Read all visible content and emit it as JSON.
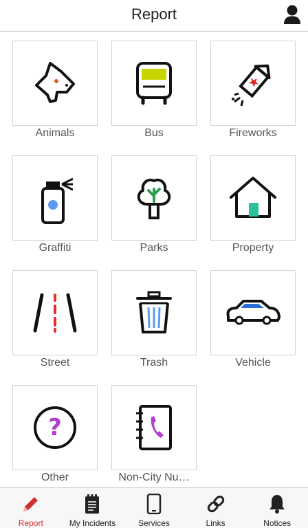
{
  "header": {
    "title": "Report",
    "profile_icon": "user-icon"
  },
  "tiles": [
    {
      "label": "Animals",
      "icon": "dog-icon"
    },
    {
      "label": "Bus",
      "icon": "bus-icon"
    },
    {
      "label": "Fireworks",
      "icon": "firework-rocket-icon"
    },
    {
      "label": "Graffiti",
      "icon": "spray-can-icon"
    },
    {
      "label": "Parks",
      "icon": "tree-icon"
    },
    {
      "label": "Property",
      "icon": "house-icon"
    },
    {
      "label": "Street",
      "icon": "road-icon"
    },
    {
      "label": "Trash",
      "icon": "trash-can-icon"
    },
    {
      "label": "Vehicle",
      "icon": "car-icon"
    },
    {
      "label": "Other",
      "icon": "question-mark-icon"
    },
    {
      "label": "Non-City Nu…",
      "icon": "phone-book-icon"
    }
  ],
  "tabbar": {
    "tabs": [
      {
        "label": "Report",
        "icon": "pencil-icon",
        "active": true
      },
      {
        "label": "My Incidents",
        "icon": "notepad-icon",
        "active": false
      },
      {
        "label": "Services",
        "icon": "smartphone-icon",
        "active": false
      },
      {
        "label": "Links",
        "icon": "link-icon",
        "active": false
      },
      {
        "label": "Notices",
        "icon": "bell-icon",
        "active": false
      }
    ]
  },
  "colors": {
    "accent_red": "#d32f2f",
    "bus_yellow": "#c8d400",
    "paint_blue": "#5b9bf0",
    "house_teal": "#2bbf9a",
    "tree_green": "#2e9e4f",
    "question_purple": "#b13fd0",
    "border": "#d4d4d4"
  }
}
